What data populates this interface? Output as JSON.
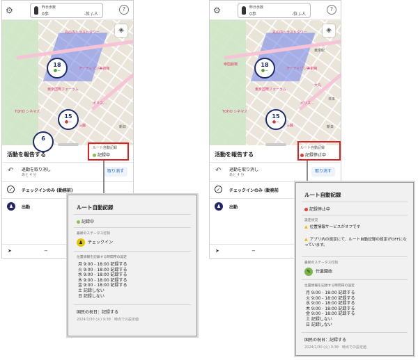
{
  "header": {
    "step_label": "昨日歩数",
    "step_value": "0歩",
    "rank_value": "-位 /-人"
  },
  "map": {
    "labels": [
      "丸の内トラストタワー",
      "アーティゾン美術館",
      "東京国際フォーラム",
      "ポリス…",
      "TOHO シネマズ",
      "三越",
      "新日",
      "東京駅",
      "帝国劇場",
      "大丸",
      "日本"
    ],
    "pins": [
      {
        "value": "18"
      },
      {
        "value": "15"
      },
      {
        "value": "6"
      }
    ]
  },
  "sheet": {
    "title": "活動を報告する",
    "route_label": "ルート自動記録",
    "undo_title": "退勤を取り消し",
    "undo_sub": "あと 4 分",
    "cancel_label": "取り消す",
    "checkin_only_label": "チェックインのみ (勤務前)",
    "checkin_only_label_r": "チェックインのみ (勤務前",
    "clock_in_label": "出勤"
  },
  "left": {
    "status": "記録中",
    "panel": {
      "title": "ルート自動記録",
      "status": "記録中",
      "last_status_label": "最新のステータス打刻",
      "last_status": "チェックイン",
      "schedule_label": "位置情報を記録する時間帯の設定",
      "schedule": [
        "月   9:00 - 18:00  記録する",
        "火   9:00 - 18:00  記録する",
        "水   9:00 - 18:00  記録する",
        "木   9:00 - 18:00  記録する",
        "金   9:00 - 18:00  記録する",
        "土   記録しない",
        "日   記録しない"
      ],
      "holiday": "国民の祝日：記録する",
      "stamp": "2024/1/30 (火) 9:38　時点での設定値"
    }
  },
  "right": {
    "status": "記録停止中",
    "panel": {
      "title": "ルート自動記録",
      "status": "記録停止中",
      "settings_label": "設定状況",
      "warn1": "位置情報サービスがオフです",
      "warn2": "アプリ内の設定にて、ルート自動記録の設定がOFFになっています。",
      "last_status_label": "最新のステータス打刻",
      "last_status": "作業開始",
      "schedule_label": "位置情報を記録する時間帯の設定",
      "schedule": [
        "月   9:00 - 18:00  記録する",
        "火   9:00 - 18:00  記録する",
        "水   9:00 - 18:00  記録する",
        "木   9:00 - 18:00  記録する",
        "金   9:00 - 18:00  記録する",
        "土   記録しない",
        "日   記録しない"
      ],
      "holiday": "国民の祝日：記録する",
      "stamp": "2024/1/30 (火) 9:38　時点での設定値"
    }
  },
  "colors": {
    "accent": "#1565c0",
    "recording": "#8bc34a",
    "stopped": "#e53935",
    "highlight": "#e02020"
  }
}
